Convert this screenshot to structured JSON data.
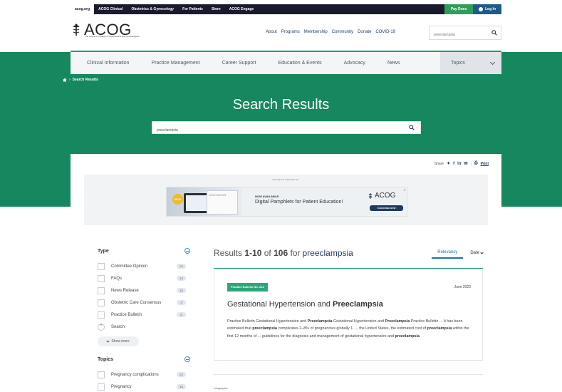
{
  "utility_bar": {
    "tabs": [
      "acog.org",
      "ACOG Clinical",
      "Obstetrics & Gynecology",
      "For Patients",
      "Store",
      "ACOG Engage"
    ],
    "pay_dues": "Pay Dues",
    "login": "Log In"
  },
  "header": {
    "logo_text": "ACOG",
    "logo_sub": "The American College of Obstetricians and Gynecologists",
    "nav": [
      "About",
      "Programs",
      "Membership",
      "Community",
      "Donate",
      "COVID-19"
    ],
    "search_value": "preeclampsia"
  },
  "secondary_nav": {
    "items": [
      "Clinical Information",
      "Practice Management",
      "Career Support",
      "Education & Events",
      "Advocacy",
      "News"
    ],
    "topics": "Topics"
  },
  "breadcrumb": "Search Results",
  "page_title": "Search Results",
  "search": {
    "value": "preeclampsia"
  },
  "share": {
    "label": "Share",
    "print": "Print"
  },
  "ad": {
    "label": "ADVERTISEMENT",
    "badge": "NEW",
    "pamphlet_word": "EDUCATION",
    "now_available": "NOW AVAILABLE:",
    "headline": "Digital Pamphlets for Patient Education!",
    "brand": "ACOG",
    "button": "SUBSCRIBE NOW",
    "close": "x"
  },
  "filters": {
    "type": {
      "title": "Type",
      "items": [
        {
          "label": "Committee Opinion",
          "count": "24"
        },
        {
          "label": "FAQs",
          "count": "19"
        },
        {
          "label": "News Release",
          "count": "10"
        },
        {
          "label": "Obstetric Care Consensus",
          "count": "3"
        },
        {
          "label": "Practice Bulletin",
          "count": "6"
        }
      ],
      "search_label": "Search",
      "show_more": "Show more"
    },
    "topics": {
      "title": "Topics",
      "items": [
        {
          "label": "Pregnancy complications",
          "count": "22"
        },
        {
          "label": "Pregnancy",
          "count": "15"
        }
      ]
    }
  },
  "results": {
    "prefix": "Results",
    "range": "1-10",
    "of": "of",
    "total": "106",
    "for": "for",
    "query": "preeclampsia",
    "sort": {
      "relevancy": "Relevancy",
      "date": "Date"
    },
    "first": {
      "tag": "Practice Bulletin No. 222",
      "date": "June 2020",
      "title_pre": "Gestational Hypertension and ",
      "title_bold": "Preeclampsia",
      "excerpt": [
        {
          "t": "Practice Bulletin Gestational Hypertension and ",
          "b": false
        },
        {
          "t": "Preeclampsia",
          "b": true
        },
        {
          "t": " Gestational Hypertension and ",
          "b": false
        },
        {
          "t": "Preeclampsia",
          "b": true
        },
        {
          "t": " Practice Bulletin ... It has been estimated that ",
          "b": false
        },
        {
          "t": "preeclampsia",
          "b": true
        },
        {
          "t": " complicates 2–8% of pregnancies globally 1. ... the United States, the estimated cost of ",
          "b": false
        },
        {
          "t": "preeclampsia",
          "b": true
        },
        {
          "t": " within the first 12 months of ... guidelines for the diagnosis and management of gestational hypertension and ",
          "b": false
        },
        {
          "t": "preeclampsia",
          "b": true
        },
        {
          "t": ".",
          "b": false
        }
      ]
    },
    "next_label": "Infographic"
  },
  "colors": {
    "brand_green": "#178760",
    "accent_green": "#2ea67a",
    "navy": "#1e3a5f",
    "link_blue": "#1e6fa8"
  }
}
